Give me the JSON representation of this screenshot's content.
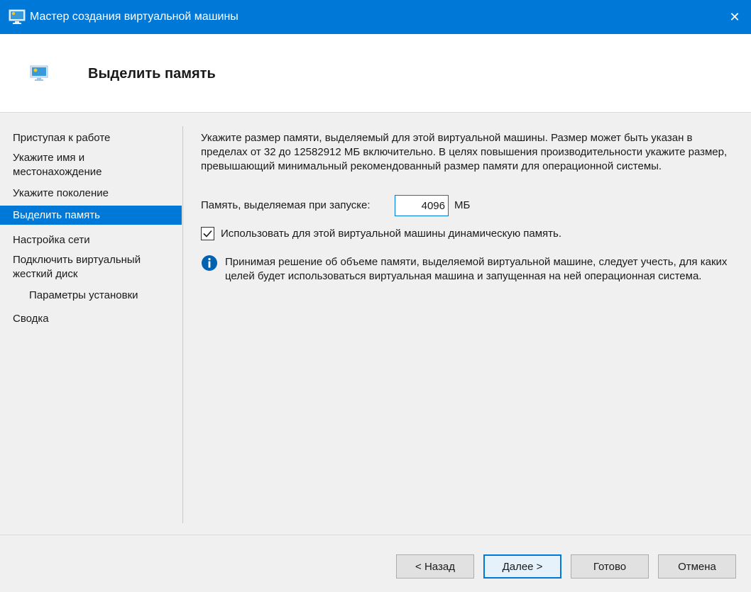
{
  "window": {
    "title": "Мастер создания виртуальной машины",
    "close_glyph": "✕"
  },
  "header": {
    "title": "Выделить память"
  },
  "sidebar": {
    "items": [
      {
        "label": "Приступая к работе"
      },
      {
        "label": "Укажите имя и местонахождение"
      },
      {
        "label": "Укажите поколение"
      },
      {
        "label": "Выделить память",
        "active": true
      },
      {
        "label": "Настройка сети"
      },
      {
        "label": "Подключить виртуальный жесткий диск"
      },
      {
        "label": "Параметры установки"
      },
      {
        "label": "Сводка"
      }
    ]
  },
  "main": {
    "description": "Укажите размер памяти, выделяемый для этой виртуальной машины. Размер может быть указан в пределах от 32 до 12582912 МБ включительно. В целях повышения производительности укажите размер, превышающий минимальный рекомендованный размер памяти для операционной системы.",
    "memory_label": "Память, выделяемая при запуске:",
    "memory_value": "4096",
    "memory_unit": "МБ",
    "dynamic_label": "Использовать для этой виртуальной машины динамическую память.",
    "dynamic_checked": true,
    "info_text": "Принимая решение об объеме памяти, выделяемой виртуальной машине, следует учесть, для каких целей будет использоваться виртуальная машина и запущенная на ней операционная система."
  },
  "footer": {
    "back": "< Назад",
    "next": "Далее >",
    "finish": "Готово",
    "cancel": "Отмена"
  },
  "icons": {
    "app": "vm-monitor-icon",
    "header": "vm-monitor-icon",
    "close": "close-icon",
    "check": "checkmark-icon",
    "info": "info-icon"
  },
  "colors": {
    "accent": "#0078d7",
    "info": "#0063b1"
  }
}
